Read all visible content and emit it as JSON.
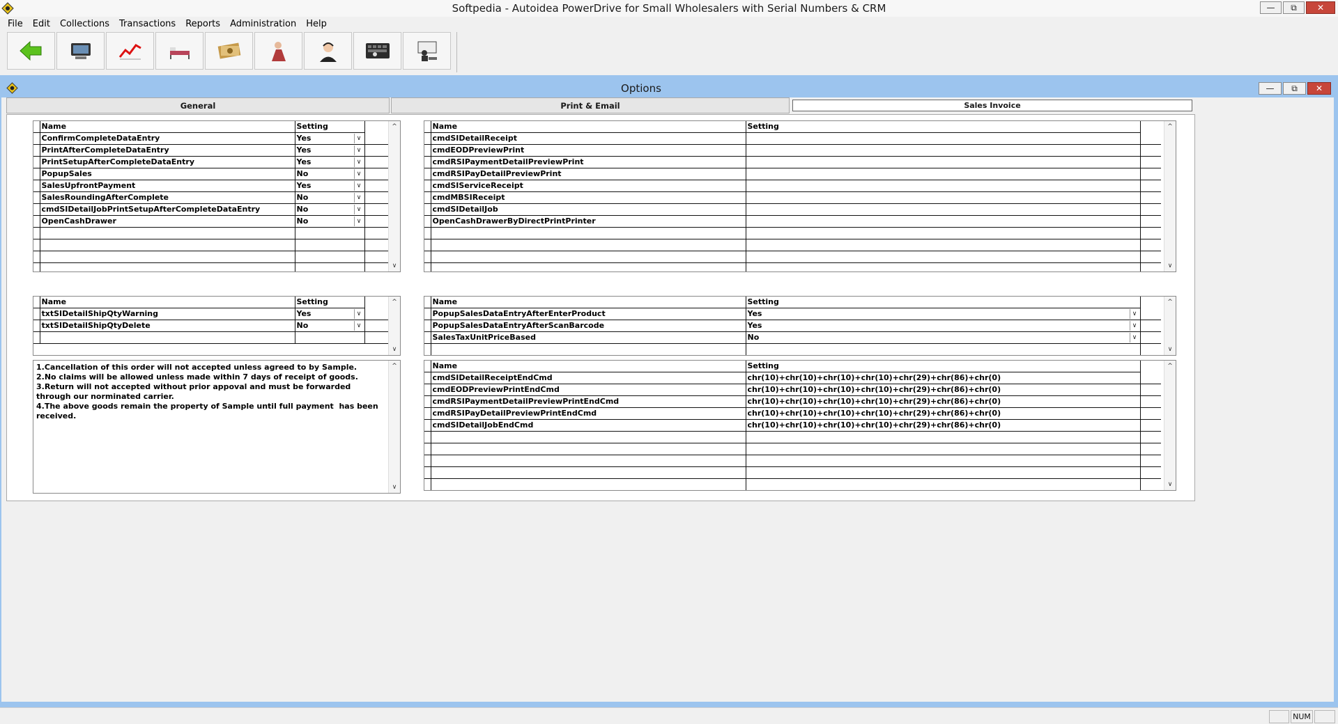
{
  "app": {
    "title": "Softpedia - Autoidea PowerDrive for Small Wholesalers with Serial Numbers & CRM",
    "menu": [
      "File",
      "Edit",
      "Collections",
      "Transactions",
      "Reports",
      "Administration",
      "Help"
    ],
    "toolbar": [
      {
        "icon": "back-arrow-icon"
      },
      {
        "icon": "pos-terminal-icon"
      },
      {
        "icon": "sales-chart-icon"
      },
      {
        "icon": "bed-icon"
      },
      {
        "icon": "money-icon"
      },
      {
        "icon": "person-icon"
      },
      {
        "icon": "support-agent-icon"
      },
      {
        "icon": "keyboard-icon"
      },
      {
        "icon": "presenter-icon"
      }
    ]
  },
  "child": {
    "title": "Options",
    "tabs": [
      "General",
      "Print & Email",
      "Sales Invoice"
    ],
    "active_tab": "Sales Invoice"
  },
  "grids": {
    "left_top": {
      "headers": [
        "Name",
        "Setting"
      ],
      "rows": [
        [
          "ConfirmCompleteDataEntry",
          "Yes"
        ],
        [
          "PrintAfterCompleteDataEntry",
          "Yes"
        ],
        [
          "PrintSetupAfterCompleteDataEntry",
          "Yes"
        ],
        [
          "PopupSales",
          "No"
        ],
        [
          "SalesUpfrontPayment",
          "Yes"
        ],
        [
          "SalesRoundingAfterComplete",
          "No"
        ],
        [
          "cmdSIDetailJobPrintSetupAfterCompleteDataEntry",
          "No"
        ],
        [
          "OpenCashDrawer",
          "No"
        ]
      ]
    },
    "left_mid": {
      "headers": [
        "Name",
        "Setting"
      ],
      "rows": [
        [
          "txtSIDetailShipQtyWarning",
          "Yes"
        ],
        [
          "txtSIDetailShipQtyDelete",
          "No"
        ]
      ]
    },
    "terms_text": "1.Cancellation of this order will not accepted unless agreed to by Sample.\n2.No claims will be allowed unless made within 7 days of receipt of goods.\n3.Return will not accepted without prior appoval and must be forwarded through our norminated carrier.\n4.The above goods remain the property of Sample until full payment  has been received.",
    "right_top": {
      "headers": [
        "Name",
        "Setting"
      ],
      "rows": [
        [
          "cmdSIDetailReceipt",
          ""
        ],
        [
          "cmdEODPreviewPrint",
          ""
        ],
        [
          "cmdRSIPaymentDetailPreviewPrint",
          ""
        ],
        [
          "cmdRSIPayDetailPreviewPrint",
          ""
        ],
        [
          "cmdSIServiceReceipt",
          ""
        ],
        [
          "cmdMBSIReceipt",
          ""
        ],
        [
          "cmdSIDetailJob",
          ""
        ],
        [
          "OpenCashDrawerByDirectPrintPrinter",
          ""
        ]
      ]
    },
    "right_mid": {
      "headers": [
        "Name",
        "Setting"
      ],
      "rows": [
        [
          "PopupSalesDataEntryAfterEnterProduct",
          "Yes"
        ],
        [
          "PopupSalesDataEntryAfterScanBarcode",
          "Yes"
        ],
        [
          "SalesTaxUnitPriceBased",
          "No"
        ]
      ]
    },
    "right_bottom": {
      "headers": [
        "Name",
        "Setting"
      ],
      "rows": [
        [
          "cmdSIDetailReceiptEndCmd",
          "chr(10)+chr(10)+chr(10)+chr(10)+chr(29)+chr(86)+chr(0)"
        ],
        [
          "cmdEODPreviewPrintEndCmd",
          "chr(10)+chr(10)+chr(10)+chr(10)+chr(29)+chr(86)+chr(0)"
        ],
        [
          "cmdRSIPaymentDetailPreviewPrintEndCmd",
          "chr(10)+chr(10)+chr(10)+chr(10)+chr(29)+chr(86)+chr(0)"
        ],
        [
          "cmdRSIPayDetailPreviewPrintEndCmd",
          "chr(10)+chr(10)+chr(10)+chr(10)+chr(29)+chr(86)+chr(0)"
        ],
        [
          "cmdSIDetailJobEndCmd",
          "chr(10)+chr(10)+chr(10)+chr(10)+chr(29)+chr(86)+chr(0)"
        ]
      ]
    }
  },
  "status": {
    "num": "NUM"
  },
  "colors": {
    "mdi_background": "#9cc4ee",
    "close_button": "#c7463a"
  }
}
